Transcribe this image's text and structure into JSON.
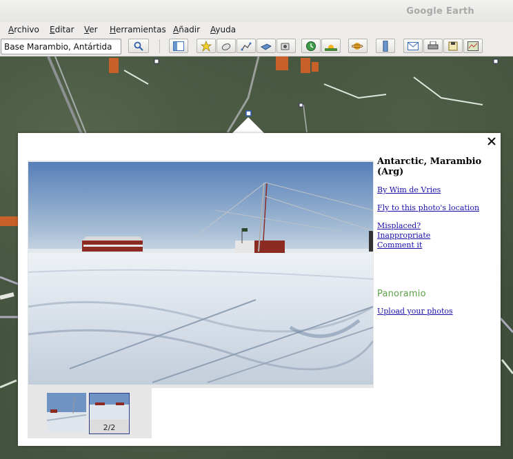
{
  "window": {
    "app_title": "Google Earth"
  },
  "menubar": {
    "items": [
      "Archivo",
      "Editar",
      "Ver",
      "Herramientas",
      "Añadir",
      "Ayuda"
    ]
  },
  "toolbar": {
    "search_value": "Base Marambio, Antártida",
    "buttons": [
      {
        "name": "search-icon"
      },
      {
        "name": "sidebar-icon"
      },
      {
        "name": "placemark-icon"
      },
      {
        "name": "polygon-icon"
      },
      {
        "name": "path-icon"
      },
      {
        "name": "image-overlay-icon"
      },
      {
        "name": "record-tour-icon"
      },
      {
        "name": "historical-imagery-icon"
      },
      {
        "name": "sunlight-icon"
      },
      {
        "name": "planet-icon"
      },
      {
        "name": "ruler-icon"
      },
      {
        "name": "email-icon"
      },
      {
        "name": "print-icon"
      },
      {
        "name": "save-image-icon"
      },
      {
        "name": "view-in-maps-icon"
      }
    ]
  },
  "balloon": {
    "title": "Antarctic, Marambio (Arg)",
    "author_link": "By Wim de Vries",
    "fly_link": "Fly to this photo's location",
    "misplaced_link": "Misplaced?",
    "inappropriate_link": "Inappropriate",
    "comment_link": "Comment it",
    "logo": "Panoramio",
    "upload_link": "Upload your photos",
    "thumb_counter": "2/2",
    "close_icon": "close-icon"
  },
  "colors": {
    "link": "#1a0dab",
    "panoramio_green": "#5ba04a",
    "selected_border": "#2a3e8c"
  }
}
